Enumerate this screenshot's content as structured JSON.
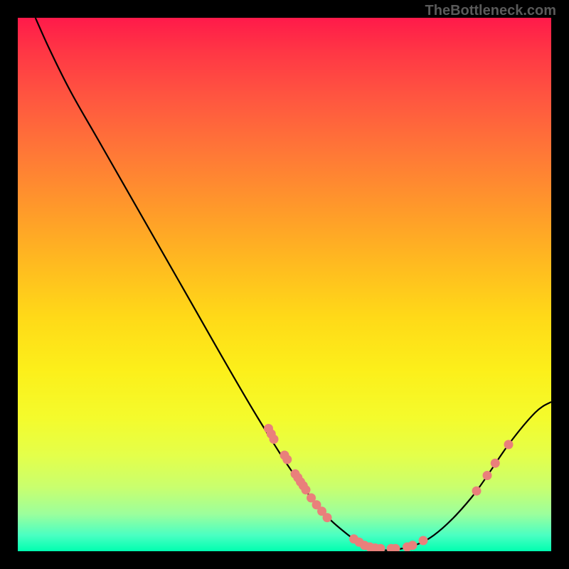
{
  "watermark": "TheBottleneck.com",
  "chart_data": {
    "type": "line",
    "title": "",
    "xlabel": "",
    "ylabel": "",
    "xlim": [
      0,
      100
    ],
    "ylim": [
      0,
      100
    ],
    "grid": false,
    "curve": [
      {
        "x": 3.3,
        "y": 100
      },
      {
        "x": 6,
        "y": 94
      },
      {
        "x": 10,
        "y": 86
      },
      {
        "x": 16,
        "y": 75.5
      },
      {
        "x": 30,
        "y": 51
      },
      {
        "x": 45,
        "y": 25
      },
      {
        "x": 55,
        "y": 10
      },
      {
        "x": 62,
        "y": 3
      },
      {
        "x": 67,
        "y": 0.5
      },
      {
        "x": 72,
        "y": 0.5
      },
      {
        "x": 78,
        "y": 3
      },
      {
        "x": 85,
        "y": 10
      },
      {
        "x": 92,
        "y": 20
      },
      {
        "x": 97,
        "y": 26
      },
      {
        "x": 100,
        "y": 28
      }
    ],
    "dots": [
      {
        "x": 47,
        "y": 23
      },
      {
        "x": 47.5,
        "y": 22
      },
      {
        "x": 48,
        "y": 21
      },
      {
        "x": 50,
        "y": 18
      },
      {
        "x": 50.5,
        "y": 17.2
      },
      {
        "x": 52,
        "y": 14.5
      },
      {
        "x": 52.5,
        "y": 13.8
      },
      {
        "x": 53,
        "y": 13
      },
      {
        "x": 53.5,
        "y": 12.3
      },
      {
        "x": 54,
        "y": 11.5
      },
      {
        "x": 55,
        "y": 10
      },
      {
        "x": 56,
        "y": 8.7
      },
      {
        "x": 57,
        "y": 7.5
      },
      {
        "x": 58,
        "y": 6.3
      },
      {
        "x": 63,
        "y": 2.3
      },
      {
        "x": 64,
        "y": 1.7
      },
      {
        "x": 65,
        "y": 1.1
      },
      {
        "x": 66,
        "y": 0.8
      },
      {
        "x": 67,
        "y": 0.6
      },
      {
        "x": 68,
        "y": 0.5
      },
      {
        "x": 70,
        "y": 0.5
      },
      {
        "x": 70.8,
        "y": 0.5
      },
      {
        "x": 73,
        "y": 0.8
      },
      {
        "x": 74,
        "y": 1.1
      },
      {
        "x": 76,
        "y": 2.0
      },
      {
        "x": 86,
        "y": 11.3
      },
      {
        "x": 88,
        "y": 14.2
      },
      {
        "x": 89.5,
        "y": 16.5
      },
      {
        "x": 92,
        "y": 20
      }
    ]
  }
}
